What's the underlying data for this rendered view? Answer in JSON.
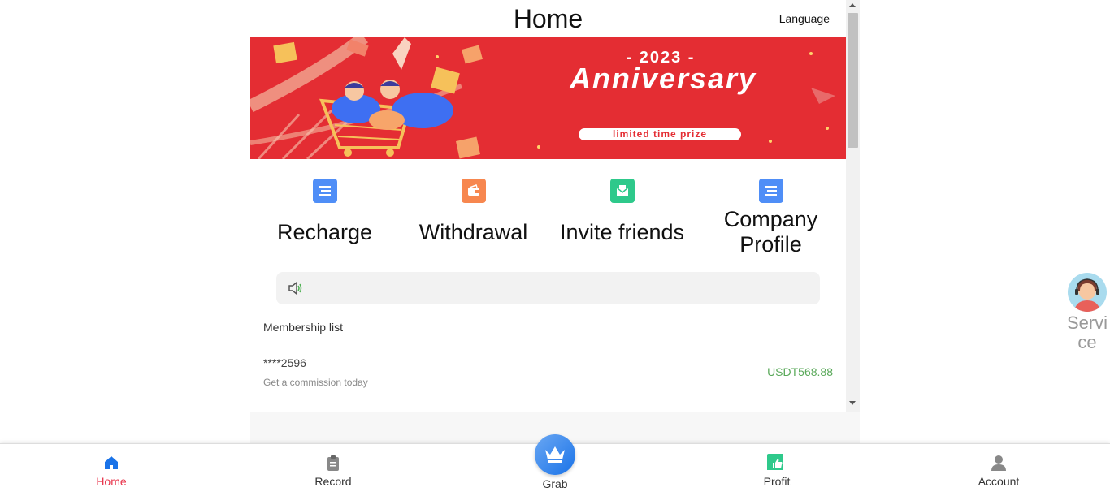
{
  "header": {
    "title": "Home",
    "language_label": "Language"
  },
  "banner": {
    "year": "- 2023 -",
    "title": "Anniversary",
    "pill": "limited time prize"
  },
  "quick_actions": [
    {
      "label": "Recharge",
      "icon": "card-icon",
      "color": "#4f8ef7"
    },
    {
      "label": "Withdrawal",
      "icon": "wallet-icon",
      "color": "#f7874f"
    },
    {
      "label": "Invite friends",
      "icon": "envelope-icon",
      "color": "#2ec98b"
    },
    {
      "label": "Company Profile",
      "icon": "card-icon",
      "color": "#4f8ef7"
    }
  ],
  "notice": {
    "icon": "speaker-icon",
    "text": ""
  },
  "membership": {
    "title": "Membership list",
    "items": [
      {
        "name": "****2596",
        "subtitle": "Get a commission today",
        "amount": "USDT568.88"
      }
    ]
  },
  "service": {
    "label": "Service"
  },
  "tabbar": {
    "active": "Home",
    "active_color": "#e8334a",
    "home": "Home",
    "record": "Record",
    "grab": "Grab",
    "profit": "Profit",
    "account": "Account"
  },
  "colors": {
    "banner": "#e42d33",
    "accent_blue": "#1a73e8",
    "amount_green": "#5aa95a"
  }
}
